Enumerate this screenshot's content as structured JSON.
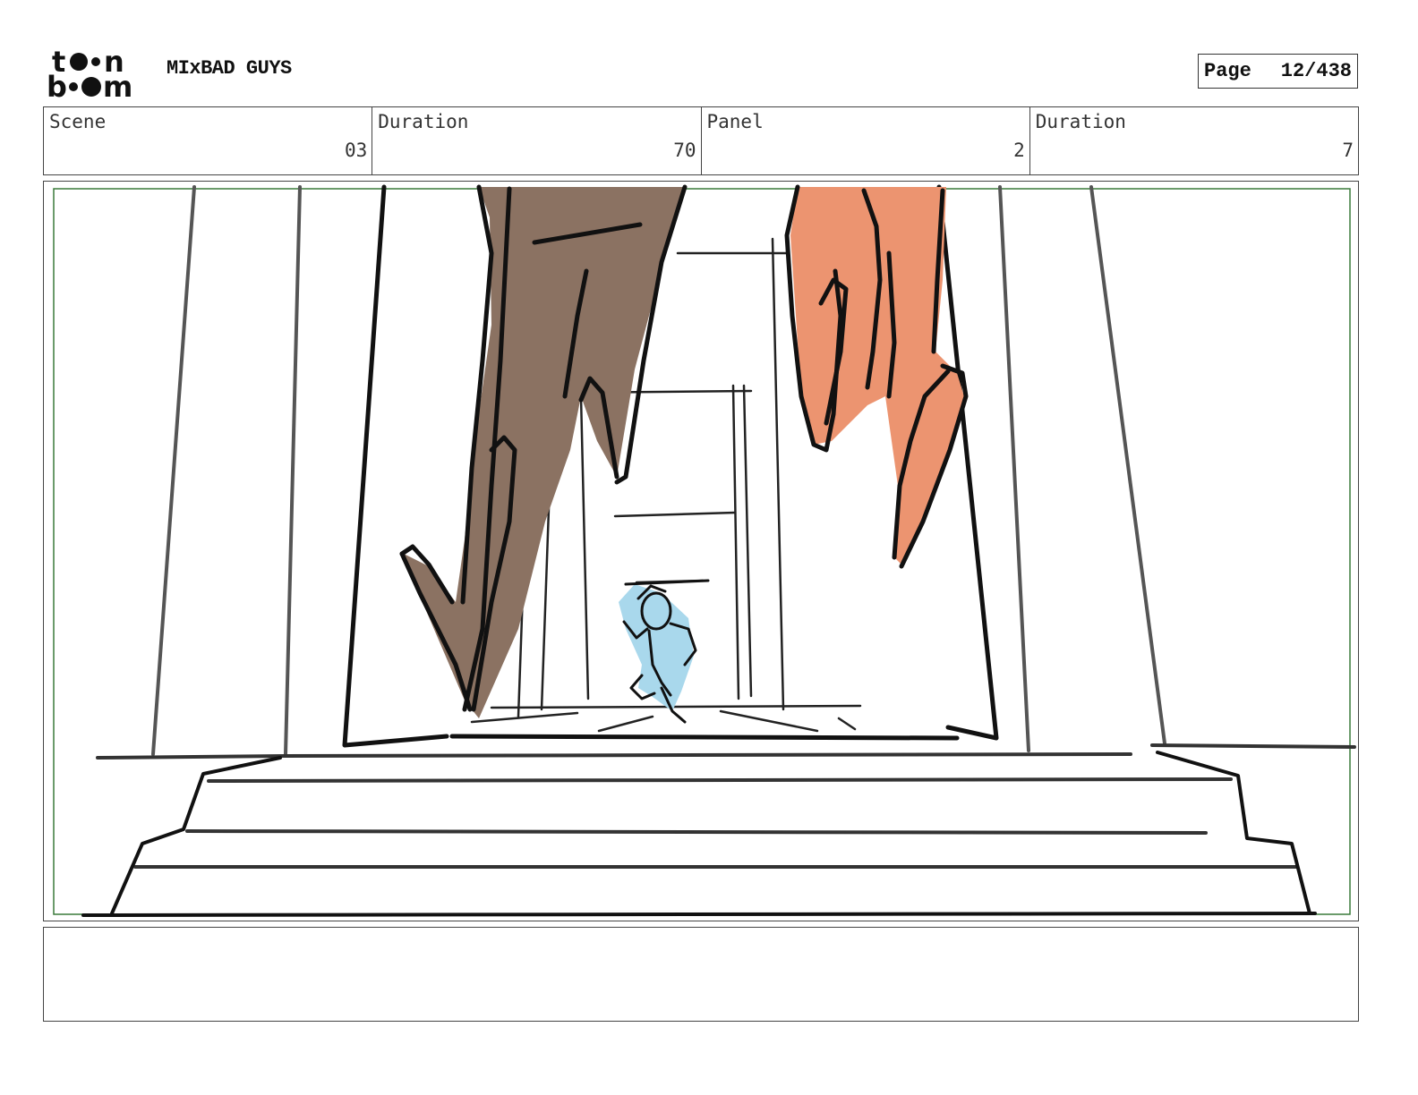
{
  "header": {
    "logo_top": "to n",
    "logo_bottom": "b m",
    "project_title": "MIxBAD GUYS",
    "page_label": "Page",
    "page_number": "12/438"
  },
  "info": {
    "scene_label": "Scene",
    "scene_value": "03",
    "scene_duration_label": "Duration",
    "scene_duration_value": "70",
    "panel_label": "Panel",
    "panel_value": "2",
    "panel_duration_label": "Duration",
    "panel_duration_value": "7"
  },
  "panel": {
    "safe_frame_color": "#3a7a3a",
    "colors": {
      "brown_figure": "#8b7262",
      "orange_figure": "#ec9470",
      "blue_figure": "#a9d8ec",
      "ink": "#111111",
      "pencil": "#555555"
    }
  },
  "notes": {
    "text": ""
  }
}
